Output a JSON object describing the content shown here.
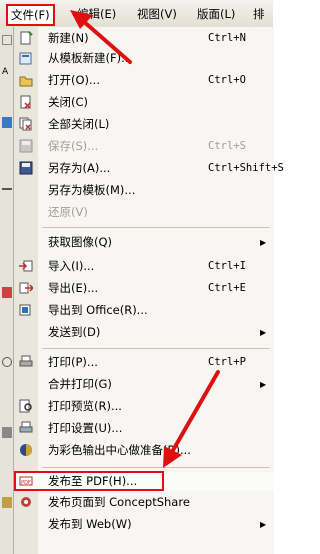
{
  "menubar": {
    "items": [
      {
        "label": "文件",
        "key": "(F)"
      },
      {
        "label": "编辑",
        "key": "(E)"
      },
      {
        "label": "视图",
        "key": "(V)"
      },
      {
        "label": "版面",
        "key": "(L)"
      },
      {
        "label": "排",
        "key": ""
      }
    ]
  },
  "menu": {
    "items": [
      {
        "label": "新建(N)",
        "shortcut": "Ctrl+N",
        "icon": "new-document-icon"
      },
      {
        "label": "从模板新建(F)...",
        "shortcut": "",
        "icon": "template-icon"
      },
      {
        "label": "打开(O)...",
        "shortcut": "Ctrl+O",
        "icon": "open-folder-icon"
      },
      {
        "label": "关闭(C)",
        "shortcut": "",
        "icon": "close-doc-icon"
      },
      {
        "label": "全部关闭(L)",
        "shortcut": "",
        "icon": "close-all-icon"
      },
      {
        "label": "保存(S)...",
        "shortcut": "Ctrl+S",
        "icon": "save-icon"
      },
      {
        "label": "另存为(A)...",
        "shortcut": "Ctrl+Shift+S",
        "icon": "save-as-icon"
      },
      {
        "label": "另存为模板(M)...",
        "shortcut": "",
        "icon": "save-template-icon"
      },
      {
        "label": "还原(V)",
        "shortcut": "",
        "icon": "revert-icon"
      },
      {
        "label": "获取图像(Q)",
        "shortcut": "",
        "icon": ""
      },
      {
        "label": "导入(I)...",
        "shortcut": "Ctrl+I",
        "icon": "import-icon"
      },
      {
        "label": "导出(E)...",
        "shortcut": "Ctrl+E",
        "icon": "export-icon"
      },
      {
        "label": "导出到 Office(R)...",
        "shortcut": "",
        "icon": "export-office-icon"
      },
      {
        "label": "发送到(D)",
        "shortcut": "",
        "icon": ""
      },
      {
        "label": "打印(P)...",
        "shortcut": "Ctrl+P",
        "icon": "print-icon"
      },
      {
        "label": "合并打印(G)",
        "shortcut": "",
        "icon": ""
      },
      {
        "label": "打印预览(R)...",
        "shortcut": "",
        "icon": "print-preview-icon"
      },
      {
        "label": "打印设置(U)...",
        "shortcut": "",
        "icon": "print-setup-icon"
      },
      {
        "label": "为彩色输出中心做准备(R)...",
        "shortcut": "",
        "icon": "color-output-icon"
      },
      {
        "label": "发布至 PDF(H)...",
        "shortcut": "",
        "icon": "pdf-icon"
      },
      {
        "label": "发布页面到 ConceptShare",
        "shortcut": "",
        "icon": "conceptshare-icon"
      },
      {
        "label": "发布到 Web(W)",
        "shortcut": "",
        "icon": ""
      }
    ]
  },
  "highlight_color": "#e01010"
}
